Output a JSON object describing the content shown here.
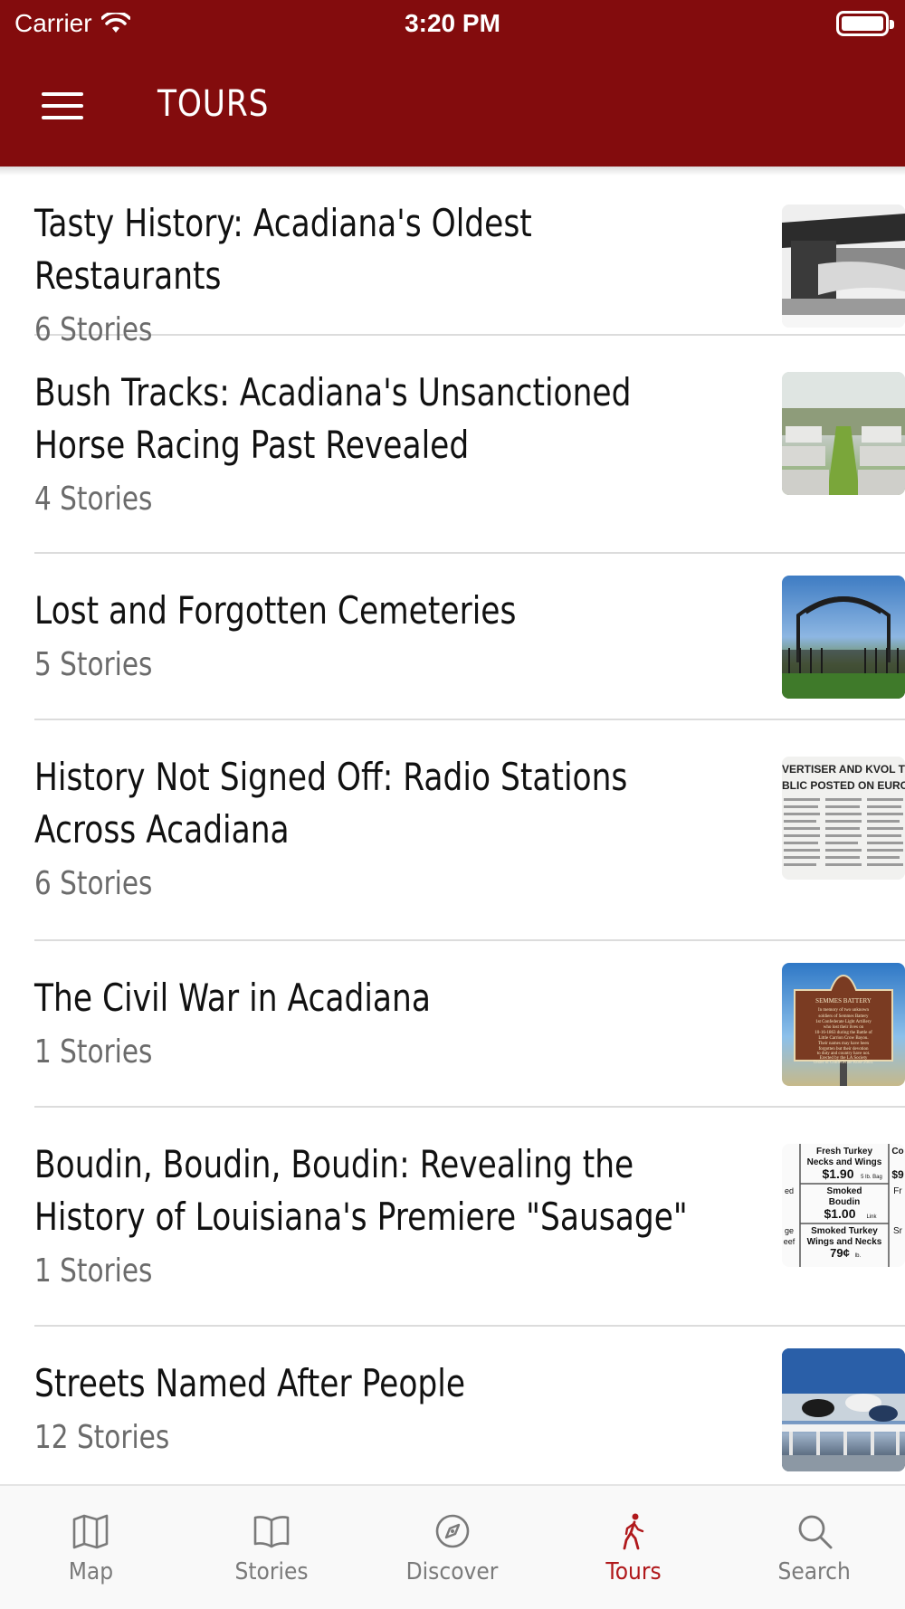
{
  "status_bar": {
    "carrier": "Carrier",
    "time": "3:20 PM"
  },
  "nav": {
    "title": "TOURS",
    "menu_icon": "hamburger-menu-icon"
  },
  "colors": {
    "header_bg": "#830c0d",
    "active_tab": "#b0191c",
    "inactive_tab": "#7a7a7a"
  },
  "tours": [
    {
      "title": "Tasty History: Acadiana's Oldest Restaurants",
      "count": "6 Stories"
    },
    {
      "title": "Bush Tracks: Acadiana's Unsanctioned Horse Racing Past Revealed",
      "count": "4 Stories"
    },
    {
      "title": "Lost and Forgotten Cemeteries",
      "count": "5 Stories"
    },
    {
      "title": "History Not Signed Off: Radio Stations Across Acadiana",
      "count": "6 Stories"
    },
    {
      "title": "The Civil War in Acadiana",
      "count": "1 Stories"
    },
    {
      "title": "Boudin, Boudin, Boudin: Revealing the History of Louisiana's Premiere \"Sausage\"",
      "count": "1 Stories"
    },
    {
      "title": "Streets Named After People",
      "count": "12 Stories"
    }
  ],
  "thumbnail_text": {
    "radio": [
      "VERTISER AND KVOL TO KEE",
      "BLIC POSTED ON EUROPE WA"
    ],
    "marker": [
      "SEMMES BATTERY",
      "In memory of two unknown",
      "soldiers of Semmes Battery",
      "1st Confederate Light Artillery",
      "who lost their lives on",
      "10-16-1863 during the Battle of",
      "Little Carrion Crow Bayou.",
      "Their names may have been",
      "forgotten but their devotion",
      "to duty and country have not.",
      "Erected by the LA Society",
      "Order of Confederate Rose 2003."
    ],
    "boudin": [
      "Fresh Turkey",
      "Necks and Wings",
      "$1.90",
      "5 lb. Bag",
      "Smoked",
      "Boudin",
      "$1.00",
      "Link",
      "Smoked Turkey",
      "Wings and Necks",
      "79¢",
      "lb.",
      "Co",
      "$9",
      "Fr",
      "Sr",
      "ed",
      "ge",
      "eef"
    ]
  },
  "tabs": [
    {
      "label": "Map",
      "icon": "map-icon",
      "active": false
    },
    {
      "label": "Stories",
      "icon": "book-icon",
      "active": false
    },
    {
      "label": "Discover",
      "icon": "compass-icon",
      "active": false
    },
    {
      "label": "Tours",
      "icon": "walking-person-icon",
      "active": true
    },
    {
      "label": "Search",
      "icon": "search-icon",
      "active": false
    }
  ]
}
